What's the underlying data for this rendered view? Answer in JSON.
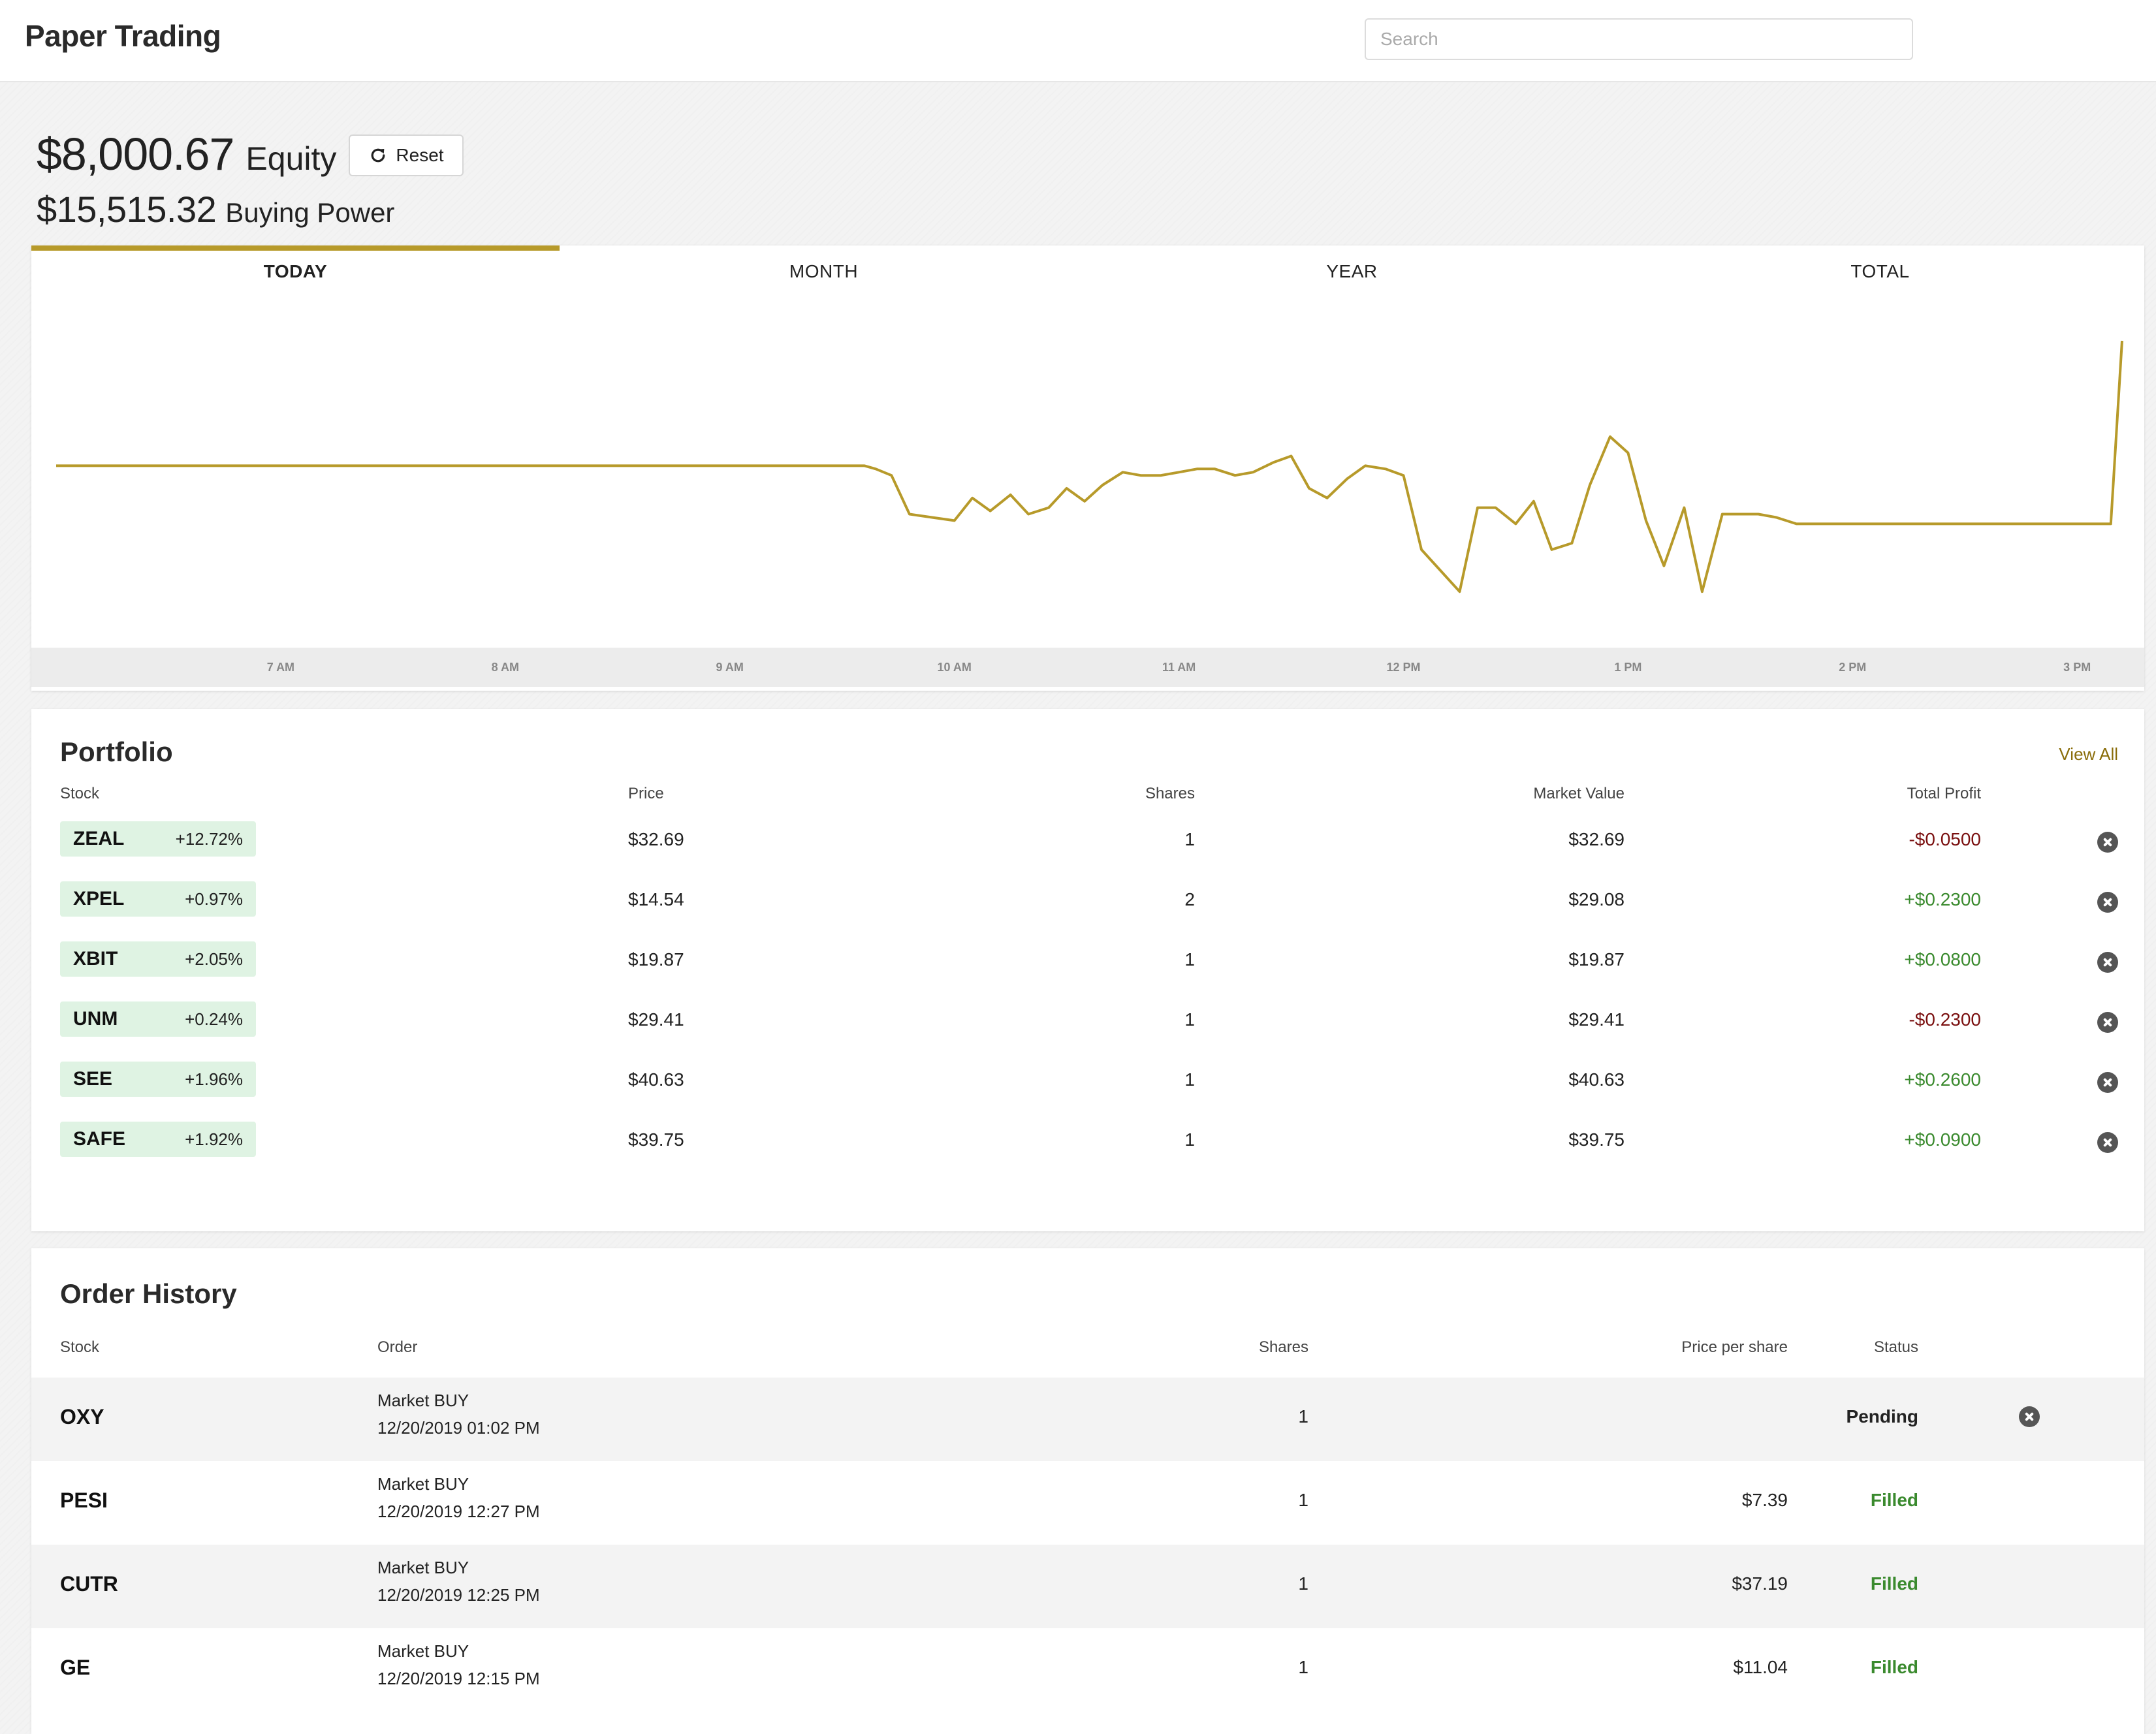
{
  "app": {
    "title": "Paper Trading"
  },
  "search": {
    "placeholder": "Search",
    "value": ""
  },
  "account": {
    "equity_value": "$8,000.67",
    "equity_label": "Equity",
    "reset_label": "Reset",
    "buying_power_value": "$15,515.32",
    "buying_power_label": "Buying Power"
  },
  "tabs": [
    {
      "label": "TODAY",
      "active": true
    },
    {
      "label": "MONTH",
      "active": false
    },
    {
      "label": "YEAR",
      "active": false
    },
    {
      "label": "TOTAL",
      "active": false
    }
  ],
  "chart_data": {
    "type": "line",
    "title": "",
    "xlabel": "",
    "ylabel": "",
    "x_ticks": [
      "7 AM",
      "8 AM",
      "9 AM",
      "10 AM",
      "11 AM",
      "12 PM",
      "1 PM",
      "2 PM",
      "3 PM"
    ],
    "x_range_hours": [
      6.0,
      15.2
    ],
    "y_range_dollars": [
      7992.5,
      8001.6
    ],
    "series": [
      {
        "color": "#b79a2a",
        "points": [
          [
            6.0,
            7996.8
          ],
          [
            9.6,
            7996.8
          ],
          [
            9.65,
            7996.7
          ],
          [
            9.72,
            7996.5
          ],
          [
            9.8,
            7995.3
          ],
          [
            9.9,
            7995.2
          ],
          [
            10.0,
            7995.1
          ],
          [
            10.08,
            7995.8
          ],
          [
            10.16,
            7995.4
          ],
          [
            10.25,
            7995.9
          ],
          [
            10.33,
            7995.3
          ],
          [
            10.42,
            7995.5
          ],
          [
            10.5,
            7996.1
          ],
          [
            10.58,
            7995.7
          ],
          [
            10.66,
            7996.2
          ],
          [
            10.75,
            7996.6
          ],
          [
            10.83,
            7996.5
          ],
          [
            10.92,
            7996.5
          ],
          [
            11.0,
            7996.6
          ],
          [
            11.08,
            7996.7
          ],
          [
            11.16,
            7996.7
          ],
          [
            11.25,
            7996.5
          ],
          [
            11.33,
            7996.6
          ],
          [
            11.42,
            7996.9
          ],
          [
            11.5,
            7997.1
          ],
          [
            11.58,
            7996.1
          ],
          [
            11.66,
            7995.8
          ],
          [
            11.75,
            7996.4
          ],
          [
            11.83,
            7996.8
          ],
          [
            11.92,
            7996.7
          ],
          [
            12.0,
            7996.5
          ],
          [
            12.08,
            7994.2
          ],
          [
            12.25,
            7992.9
          ],
          [
            12.33,
            7995.5
          ],
          [
            12.41,
            7995.5
          ],
          [
            12.5,
            7995.0
          ],
          [
            12.58,
            7995.7
          ],
          [
            12.66,
            7994.2
          ],
          [
            12.75,
            7994.4
          ],
          [
            12.83,
            7996.2
          ],
          [
            12.92,
            7997.7
          ],
          [
            13.0,
            7997.2
          ],
          [
            13.08,
            7995.1
          ],
          [
            13.16,
            7993.7
          ],
          [
            13.25,
            7995.5
          ],
          [
            13.33,
            7992.9
          ],
          [
            13.42,
            7995.3
          ],
          [
            13.58,
            7995.3
          ],
          [
            13.66,
            7995.2
          ],
          [
            13.75,
            7995.0
          ],
          [
            13.92,
            7995.0
          ],
          [
            14.0,
            7995.0
          ],
          [
            14.08,
            7995.0
          ],
          [
            14.25,
            7995.0
          ],
          [
            14.33,
            7995.0
          ],
          [
            14.5,
            7995.0
          ],
          [
            14.58,
            7995.0
          ],
          [
            14.75,
            7995.0
          ],
          [
            14.92,
            7995.0
          ],
          [
            15.0,
            7995.0
          ],
          [
            15.08,
            7995.0
          ],
          [
            15.15,
            7995.0
          ],
          [
            15.2,
            8000.67
          ]
        ]
      }
    ],
    "grid": false,
    "legend": "none"
  },
  "portfolio": {
    "title": "Portfolio",
    "view_all": "View All",
    "columns": [
      "Stock",
      "Price",
      "Shares",
      "Market Value",
      "Total Profit"
    ],
    "rows": [
      {
        "symbol": "ZEAL",
        "change": "+12.72%",
        "price": "$32.69",
        "shares": "1",
        "market_value": "$32.69",
        "profit": "-$0.0500",
        "profit_sign": "neg"
      },
      {
        "symbol": "XPEL",
        "change": "+0.97%",
        "price": "$14.54",
        "shares": "2",
        "market_value": "$29.08",
        "profit": "+$0.2300",
        "profit_sign": "pos"
      },
      {
        "symbol": "XBIT",
        "change": "+2.05%",
        "price": "$19.87",
        "shares": "1",
        "market_value": "$19.87",
        "profit": "+$0.0800",
        "profit_sign": "pos"
      },
      {
        "symbol": "UNM",
        "change": "+0.24%",
        "price": "$29.41",
        "shares": "1",
        "market_value": "$29.41",
        "profit": "-$0.2300",
        "profit_sign": "neg"
      },
      {
        "symbol": "SEE",
        "change": "+1.96%",
        "price": "$40.63",
        "shares": "1",
        "market_value": "$40.63",
        "profit": "+$0.2600",
        "profit_sign": "pos"
      },
      {
        "symbol": "SAFE",
        "change": "+1.92%",
        "price": "$39.75",
        "shares": "1",
        "market_value": "$39.75",
        "profit": "+$0.0900",
        "profit_sign": "pos"
      }
    ]
  },
  "orders": {
    "title": "Order History",
    "columns": [
      "Stock",
      "Order",
      "Shares",
      "Price per share",
      "Status"
    ],
    "rows": [
      {
        "symbol": "OXY",
        "type": "Market BUY",
        "date": "12/20/2019 01:02 PM",
        "shares": "1",
        "price": "",
        "status": "Pending",
        "cancellable": true
      },
      {
        "symbol": "PESI",
        "type": "Market BUY",
        "date": "12/20/2019 12:27 PM",
        "shares": "1",
        "price": "$7.39",
        "status": "Filled",
        "cancellable": false
      },
      {
        "symbol": "CUTR",
        "type": "Market BUY",
        "date": "12/20/2019 12:25 PM",
        "shares": "1",
        "price": "$37.19",
        "status": "Filled",
        "cancellable": false
      },
      {
        "symbol": "GE",
        "type": "Market BUY",
        "date": "12/20/2019 12:15 PM",
        "shares": "1",
        "price": "$11.04",
        "status": "Filled",
        "cancellable": false
      }
    ]
  }
}
